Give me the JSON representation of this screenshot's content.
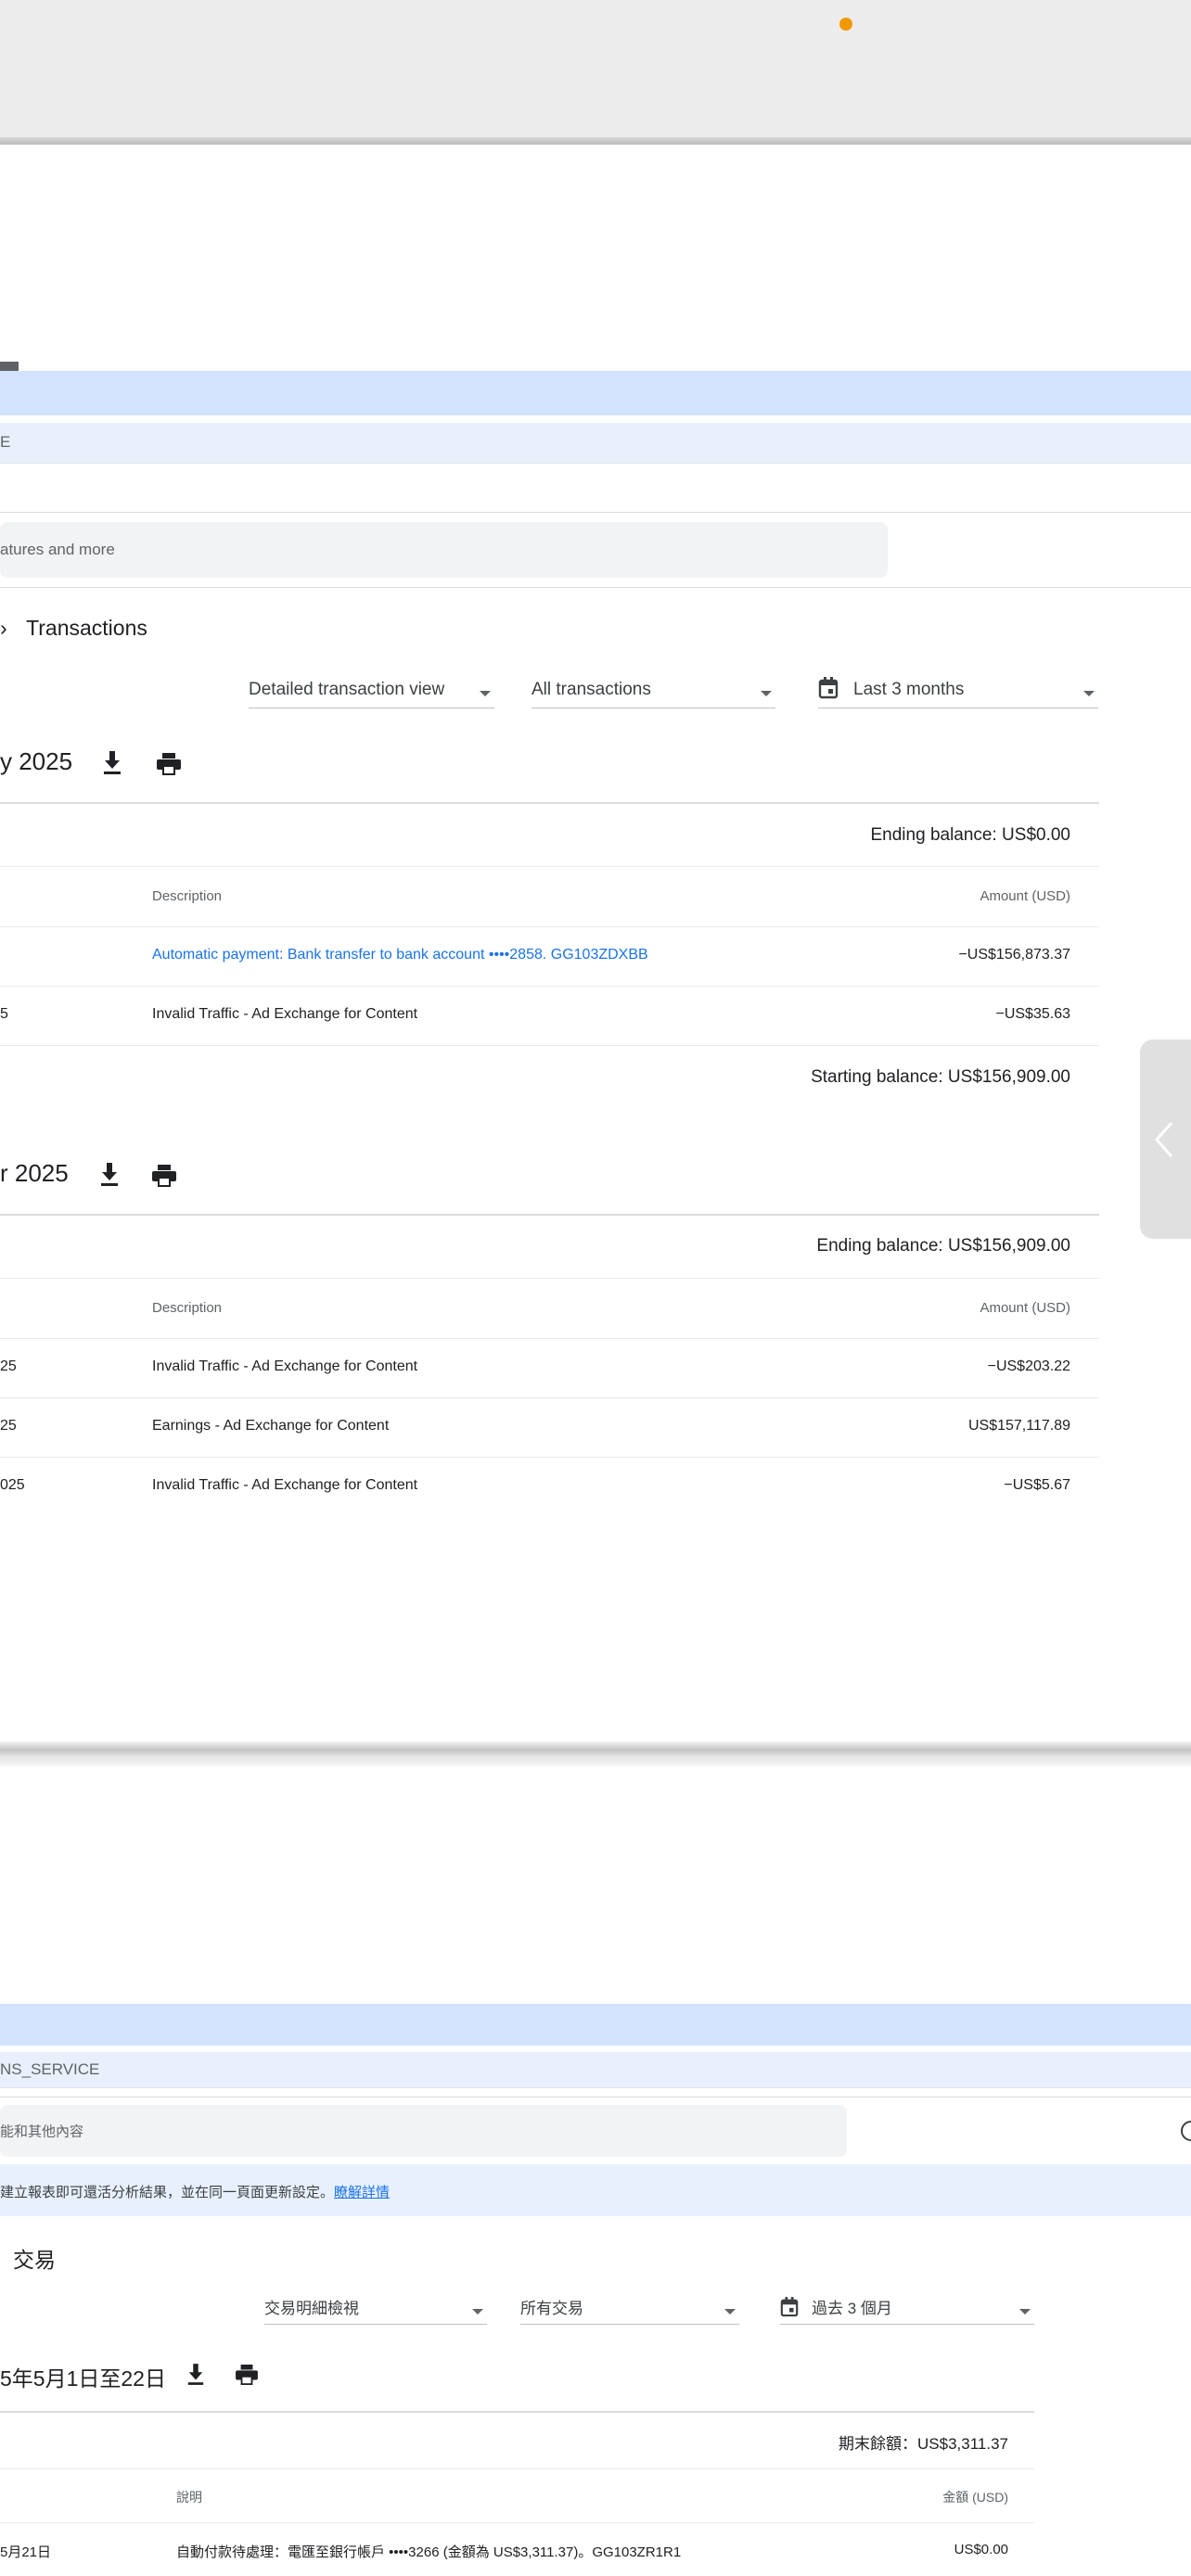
{
  "top_section": {
    "app_bar_text": "E",
    "search_placeholder": "atures and more",
    "breadcrumb_prefix": "›",
    "page_title": "Transactions",
    "filters": {
      "view": "Detailed transaction view",
      "type": "All transactions",
      "range": "Last 3 months"
    },
    "months": [
      {
        "label": "y 2025",
        "ending_balance": "Ending balance: US$0.00",
        "starting_balance": "Starting balance: US$156,909.00",
        "col_description": "Description",
        "col_amount": "Amount (USD)",
        "rows": [
          {
            "date": "",
            "description": "Automatic payment: Bank transfer to bank account ••••2858. GG103ZDXBB",
            "amount": "−US$156,873.37"
          },
          {
            "date": "5",
            "description": "Invalid Traffic - Ad Exchange for Content",
            "amount": "−US$35.63"
          }
        ]
      },
      {
        "label": "r 2025",
        "ending_balance": "Ending balance: US$156,909.00",
        "col_description": "Description",
        "col_amount": "Amount (USD)",
        "rows": [
          {
            "date": "25",
            "description": "Invalid Traffic - Ad Exchange for Content",
            "amount": "−US$203.22"
          },
          {
            "date": "25",
            "description": "Earnings - Ad Exchange for Content",
            "amount": "US$157,117.89"
          },
          {
            "date": "025",
            "description": "Invalid Traffic - Ad Exchange for Content",
            "amount": "−US$5.67"
          }
        ]
      }
    ]
  },
  "bottom_section": {
    "app_bar_text": "NS_SERVICE",
    "search_placeholder": "能和其他內容",
    "info_text": "建立報表即可還活分析結果，並在同一頁面更新設定。",
    "info_link": "瞭解詳情",
    "page_title": "交易",
    "filters": {
      "view": "交易明細檢視",
      "type": "所有交易",
      "range": "過去 3 個月"
    },
    "month_label": "5年5月1日至22日",
    "ending_balance": "期末餘額：US$3,311.37",
    "col_description": "說明",
    "col_amount": "金額 (USD)",
    "rows": [
      {
        "date": "5月21日",
        "description": "自動付款待處理：電匯至銀行帳戶 ••••3266 (金額為 US$3,311.37)。GG103ZR1R1",
        "amount": "US$0.00"
      }
    ]
  },
  "colors": {
    "accent_blue": "#1a73e8",
    "band_blue": "#d3e3fd",
    "notification_dot": "#f29900"
  },
  "icons": [
    "download-icon",
    "print-icon",
    "calendar-icon",
    "chevron-left-icon",
    "dropdown-caret-icon",
    "help-circle-icon"
  ]
}
